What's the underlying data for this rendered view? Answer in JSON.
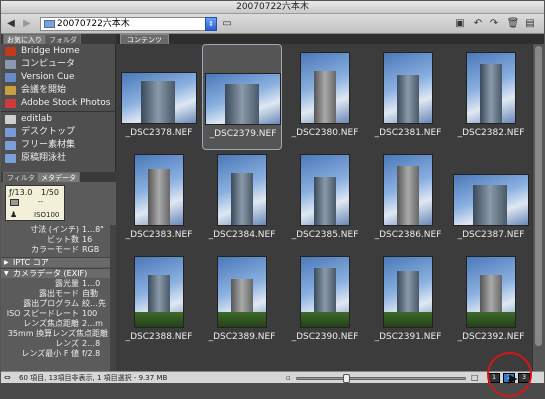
{
  "window": {
    "title": "20070722六本木"
  },
  "toolbar": {
    "path": "20070722六本木",
    "back_icon": "arrow-left-icon",
    "forward_icon": "arrow-right-icon"
  },
  "sidebar": {
    "tabs": [
      "お気に入り",
      "フォルダ"
    ],
    "favorites": [
      {
        "label": "Bridge Home",
        "icon": "bridge-home-icon",
        "color": "#c23a1a"
      },
      {
        "label": "コンピュータ",
        "icon": "computer-icon",
        "color": "#8a9ab0"
      },
      {
        "label": "Version Cue",
        "icon": "version-cue-icon",
        "color": "#6a8ac8"
      },
      {
        "label": "会議を開始",
        "icon": "meeting-icon",
        "color": "#c8a040"
      },
      {
        "label": "Adobe Stock Photos",
        "icon": "stock-photos-icon",
        "color": "#d03a3a"
      }
    ],
    "folders": [
      {
        "label": "editlab",
        "icon": "home-icon",
        "color": "#d0d0d0"
      },
      {
        "label": "デスクトップ",
        "icon": "desktop-icon",
        "color": "#7a9ad8"
      },
      {
        "label": "フリー素材集",
        "icon": "folder-icon",
        "color": "#7aa0d8"
      },
      {
        "label": "原稿翔泳社",
        "icon": "folder-icon",
        "color": "#7aa0d8"
      }
    ],
    "meta_tabs": [
      "フィルタ",
      "メタデータ"
    ],
    "camera_box": {
      "fnumber": "ƒ/13.0",
      "shutter": "1/50",
      "dash": "--",
      "iso": "ISO100"
    },
    "meta_rows": [
      {
        "k": "寸法 (インチ)",
        "v": "1…8\""
      },
      {
        "k": "ビット数",
        "v": "16"
      },
      {
        "k": "カラーモード",
        "v": "RGB"
      }
    ],
    "iptc_header": "IPTC コア",
    "exif_header": "カメラデータ (EXIF)",
    "exif_rows": [
      {
        "k": "露光量",
        "v": "1…0"
      },
      {
        "k": "露出モード",
        "v": "自動"
      },
      {
        "k": "露出プログラム",
        "v": "絞…先"
      },
      {
        "k": "ISO スピードレート",
        "v": "100"
      },
      {
        "k": "レンズ焦点距離",
        "v": "2…m"
      },
      {
        "k": "35mm 換算レンズ焦点距離",
        "v": ""
      },
      {
        "k": "レンズ",
        "v": "2…8"
      },
      {
        "k": "レンズ最小 F 値",
        "v": "f/2.8"
      }
    ]
  },
  "content": {
    "tab": "コンテンツ",
    "thumbnails": [
      {
        "name": "_DSC2378.NEF",
        "orient": "landscape",
        "selected": false
      },
      {
        "name": "_DSC2379.NEF",
        "orient": "landscape",
        "selected": true
      },
      {
        "name": "_DSC2380.NEF",
        "orient": "portrait",
        "selected": false
      },
      {
        "name": "_DSC2381.NEF",
        "orient": "portrait",
        "selected": false
      },
      {
        "name": "_DSC2382.NEF",
        "orient": "portrait",
        "selected": false
      },
      {
        "name": "_DSC2383.NEF",
        "orient": "portrait",
        "selected": false
      },
      {
        "name": "_DSC2384.NEF",
        "orient": "portrait",
        "selected": false
      },
      {
        "name": "_DSC2385.NEF",
        "orient": "portrait",
        "selected": false
      },
      {
        "name": "_DSC2386.NEF",
        "orient": "portrait",
        "selected": false
      },
      {
        "name": "_DSC2387.NEF",
        "orient": "landscape",
        "selected": false
      },
      {
        "name": "_DSC2388.NEF",
        "orient": "portrait",
        "selected": false
      },
      {
        "name": "_DSC2389.NEF",
        "orient": "portrait",
        "selected": false
      },
      {
        "name": "_DSC2390.NEF",
        "orient": "portrait",
        "selected": false
      },
      {
        "name": "_DSC2391.NEF",
        "orient": "portrait",
        "selected": false
      },
      {
        "name": "_DSC2392.NEF",
        "orient": "portrait",
        "selected": false
      }
    ]
  },
  "status": {
    "text": "60 項目, 13項目非表示, 1 項目選択 - 9.37 MB",
    "view_buttons": [
      "1",
      "2",
      "3"
    ],
    "active_view": 1,
    "zoom_level": 0.28
  },
  "colors": {
    "accent": "#2a7ad0",
    "highlight_ring": "#d01818"
  }
}
